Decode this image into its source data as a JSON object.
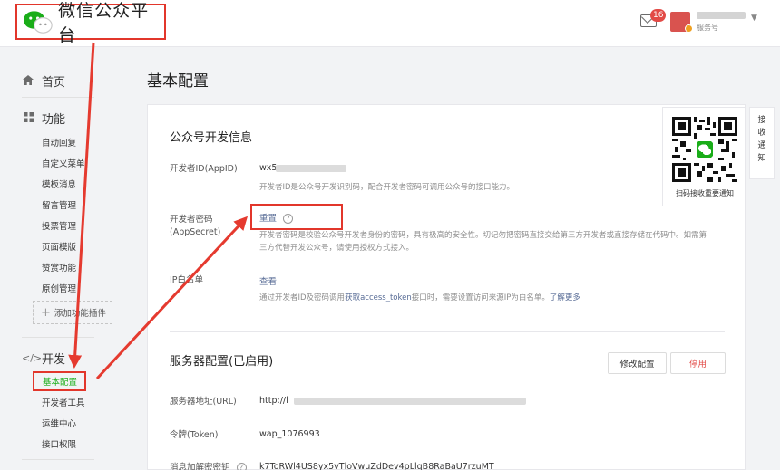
{
  "header": {
    "app_title": "微信公众平台",
    "notifications_count": "16",
    "account_type": "服务号"
  },
  "sidebar": {
    "home": "首页",
    "features": {
      "title": "功能",
      "items": [
        "自动回复",
        "自定义菜单",
        "模板消息",
        "留言管理",
        "投票管理",
        "页面模版",
        "赞赏功能",
        "原创管理"
      ],
      "add_plugin": "添加功能插件"
    },
    "dev": {
      "title": "开发",
      "items": [
        "基本配置",
        "开发者工具",
        "运维中心",
        "接口权限"
      ]
    }
  },
  "main": {
    "title": "基本配置",
    "dev_info": {
      "title": "公众号开发信息",
      "appid_label": "开发者ID(AppID)",
      "appid_value": "wx5",
      "appid_desc": "开发者ID是公众号开发识别码，配合开发者密码可调用公众号的接口能力。",
      "secret_label_1": "开发者密码",
      "secret_label_2": "(AppSecret)",
      "secret_action": "重置",
      "secret_help": "?",
      "secret_desc_1": "开发者密码是校验公众号开发者身份的密码，具有极高的安全性。切记勿把密码直接交给第三方开发者或直接存储在代码中。如需第",
      "secret_desc_2": "三方代替开发公众号，请使用授权方式接入。",
      "ip_label": "IP白名单",
      "ip_action": "查看",
      "ip_desc_pre": "通过开发者ID及密码调用",
      "ip_desc_link": "获取access_token",
      "ip_desc_post": "接口时，需要设置访问来源IP为白名单。",
      "ip_more": "了解更多"
    },
    "server": {
      "title": "服务器配置(已启用)",
      "modify_button": "修改配置",
      "stop_button": "停用",
      "url_label": "服务器地址(URL)",
      "url_value": "http://l",
      "token_label": "令牌(Token)",
      "token_value": "wap_1076993",
      "aes_label": "消息加解密密钥",
      "aes_value": "k7ToRWl4US8yx5vTloVwuZdDev4pLlqB8RaBaU7rzuMT"
    }
  },
  "qr": {
    "caption": "扫码接收重要通知"
  },
  "side_tab": {
    "label": [
      "接",
      "收",
      "通",
      "知"
    ]
  },
  "colors": {
    "accent_green": "#1aad19",
    "highlight_red": "#e2362b",
    "link_blue": "#576b95",
    "stop_red": "#e24a46"
  }
}
